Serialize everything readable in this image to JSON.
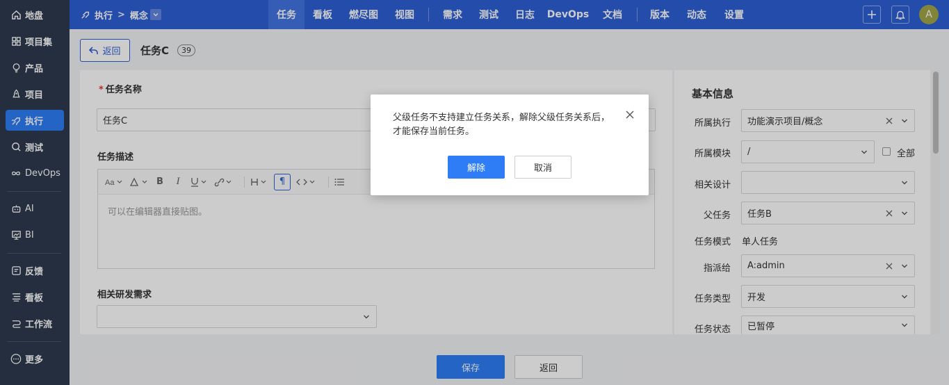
{
  "sidebar": {
    "items": [
      {
        "label": "地盘",
        "icon": "home-icon"
      },
      {
        "label": "项目集",
        "icon": "grid-icon"
      },
      {
        "label": "产品",
        "icon": "bulb-icon"
      },
      {
        "label": "项目",
        "icon": "rocket-icon"
      },
      {
        "label": "执行",
        "icon": "run-icon"
      },
      {
        "label": "测试",
        "icon": "search-icon"
      },
      {
        "label": "DevOps",
        "icon": "infinity-icon"
      },
      {
        "label": "AI",
        "icon": "robot-icon"
      },
      {
        "label": "BI",
        "icon": "chart-icon"
      },
      {
        "label": "反馈",
        "icon": "feedback-icon"
      },
      {
        "label": "看板",
        "icon": "kanban-icon"
      },
      {
        "label": "工作流",
        "icon": "workflow-icon"
      },
      {
        "label": "更多",
        "icon": "more-icon"
      }
    ],
    "active": "执行"
  },
  "topbar": {
    "crumb_root": "执行",
    "crumb_sep": ">",
    "crumb_current": "概念",
    "nav": [
      "任务",
      "看板",
      "燃尽图",
      "视图",
      "需求",
      "测试",
      "日志",
      "DevOps",
      "文档",
      "版本",
      "动态",
      "设置"
    ],
    "active_nav": "任务",
    "avatar": "A"
  },
  "header": {
    "back_label": "返回",
    "title": "任务C",
    "count": "39"
  },
  "form": {
    "name_label": "任务名称",
    "name_required": "*",
    "name_value": "任务C",
    "desc_label": "任务描述",
    "editor_placeholder": "可以在编辑器直接贴图。",
    "story_label": "相关研发需求"
  },
  "basic": {
    "title": "基本信息",
    "execution_label": "所属执行",
    "execution_value": "功能演示项目/概念",
    "module_label": "所属模块",
    "module_value": "/",
    "all_label": "全部",
    "design_label": "相关设计",
    "parent_label": "父任务",
    "parent_value": "任务B",
    "mode_label": "任务模式",
    "mode_value": "单人任务",
    "assign_label": "指派给",
    "assign_value": "A:admin",
    "type_label": "任务类型",
    "type_value": "开发",
    "status_label": "任务状态",
    "status_value": "已暂停"
  },
  "footer": {
    "save_label": "保存",
    "back_label": "返回"
  },
  "modal": {
    "message_line1": "父级任务不支持建立任务关系，解除父级任务关系后，",
    "message_line2": "才能保存当前任务。",
    "confirm_label": "解除",
    "cancel_label": "取消"
  },
  "colors": {
    "primary": "#2e7df6",
    "topbar": "#2e5fd6",
    "sidebar": "#2e3a4e"
  }
}
